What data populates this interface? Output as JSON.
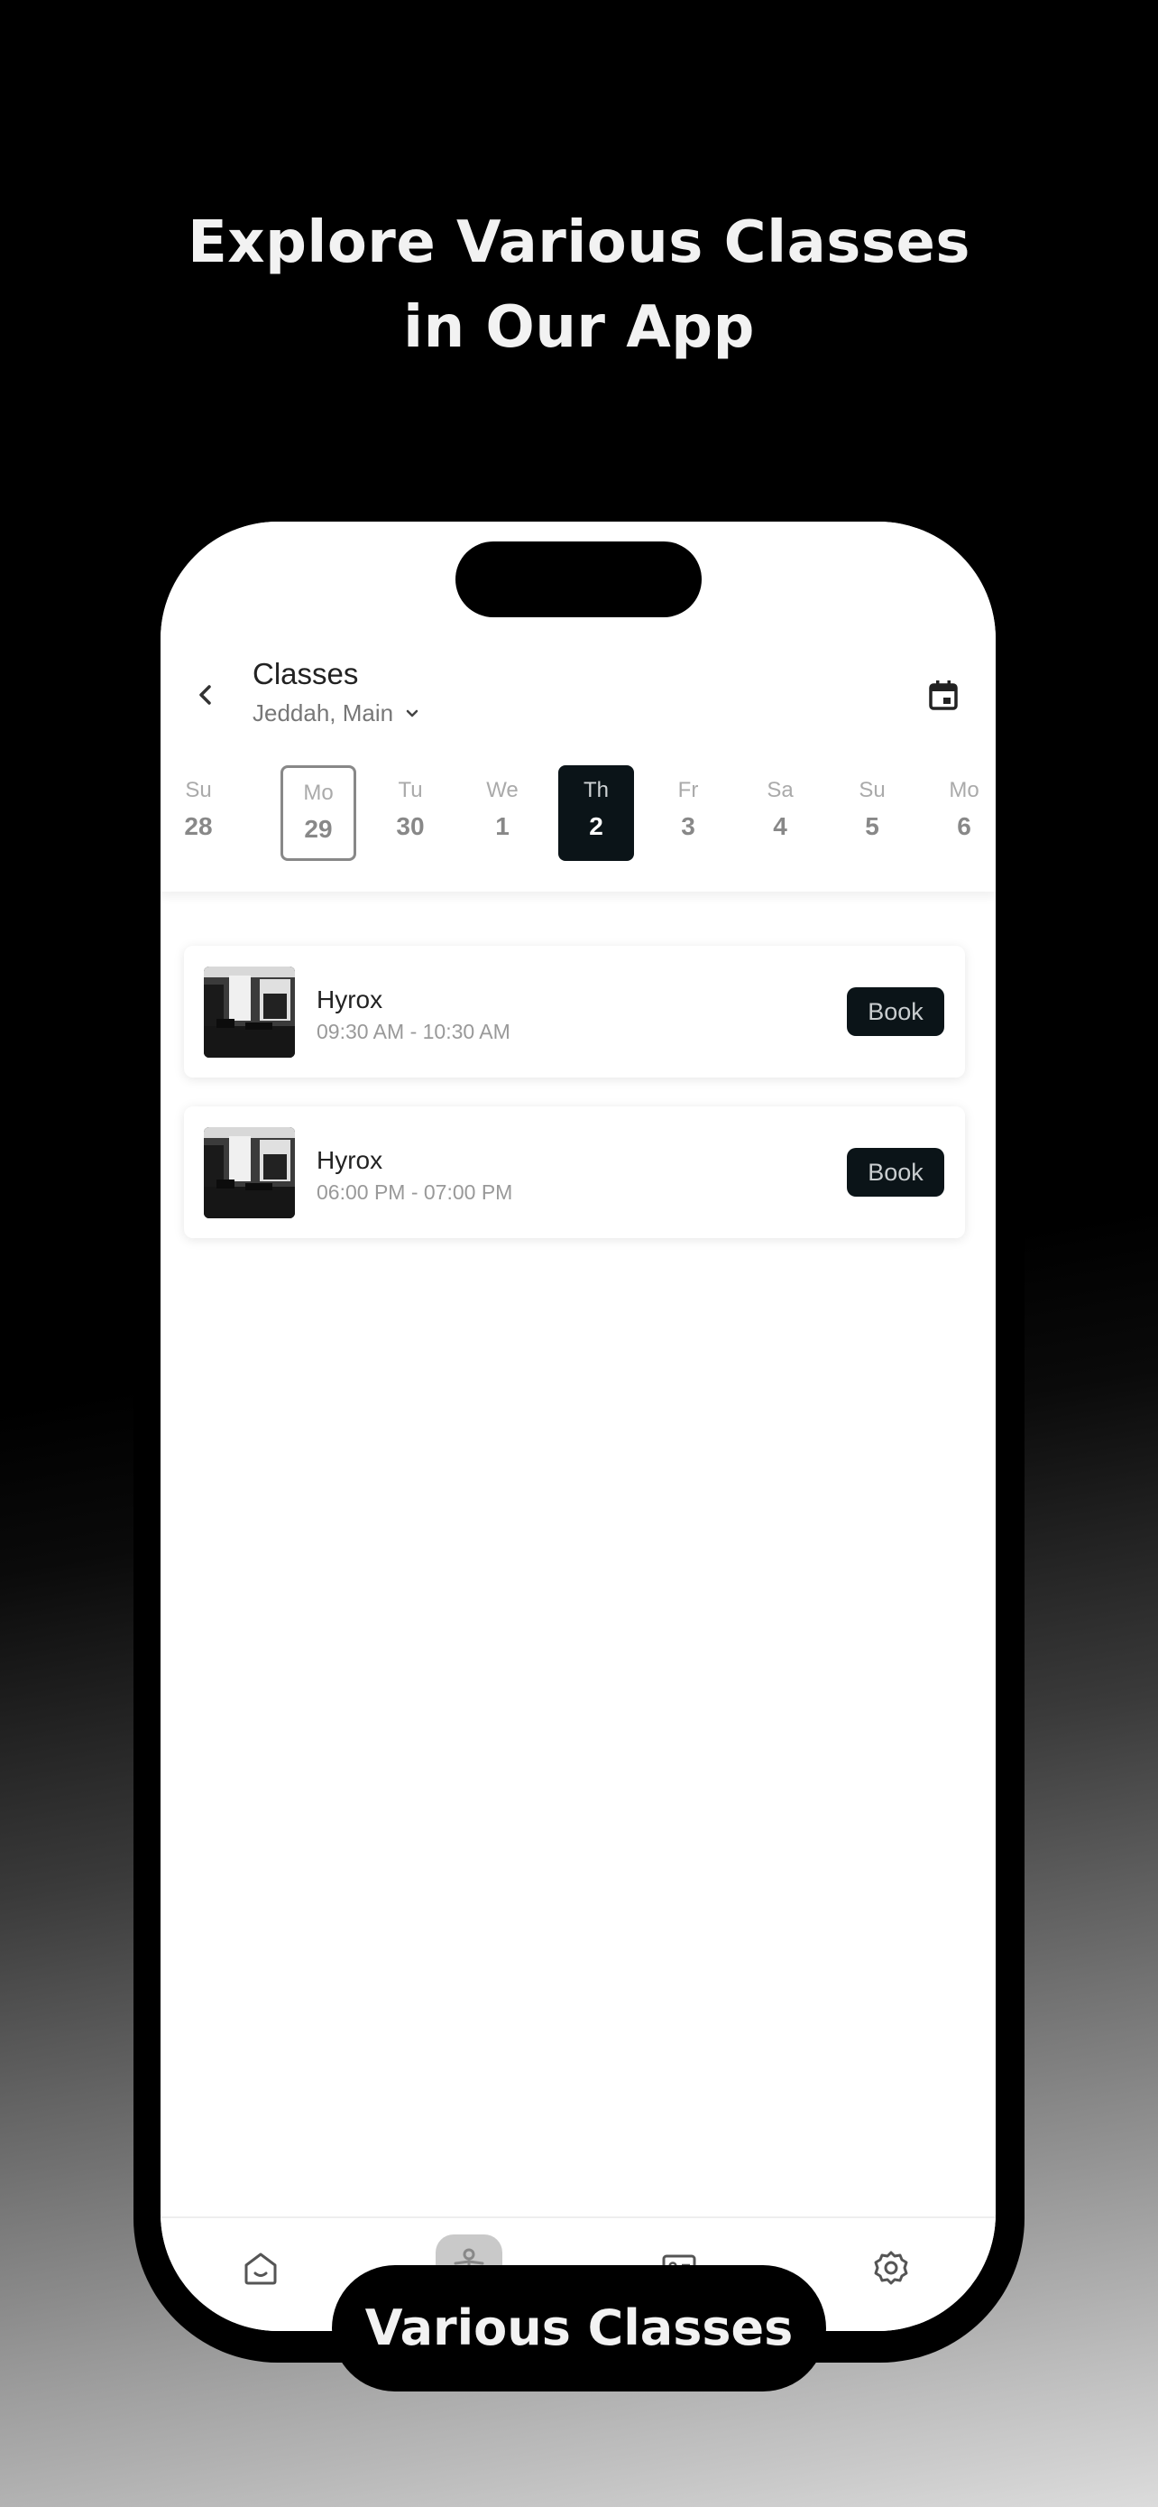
{
  "headline": {
    "line1": "Explore Various Classes",
    "line2": "in Our App"
  },
  "header": {
    "title": "Classes",
    "location": "Jeddah, Main",
    "back_icon": "chevron-left-icon",
    "calendar_icon": "calendar-icon"
  },
  "days": [
    {
      "name": "Su",
      "date": "28",
      "state": "normal"
    },
    {
      "name": "Mo",
      "date": "29",
      "state": "today"
    },
    {
      "name": "Tu",
      "date": "30",
      "state": "normal"
    },
    {
      "name": "We",
      "date": "1",
      "state": "normal"
    },
    {
      "name": "Th",
      "date": "2",
      "state": "selected"
    },
    {
      "name": "Fr",
      "date": "3",
      "state": "normal"
    },
    {
      "name": "Sa",
      "date": "4",
      "state": "normal"
    },
    {
      "name": "Su",
      "date": "5",
      "state": "normal"
    },
    {
      "name": "Mo",
      "date": "6",
      "state": "normal"
    }
  ],
  "classes": [
    {
      "name": "Hyrox",
      "time": "09:30 AM - 10:30 AM",
      "button": "Book"
    },
    {
      "name": "Hyrox",
      "time": "06:00 PM - 07:00 PM",
      "button": "Book"
    }
  ],
  "bottom_nav": [
    {
      "icon": "home-icon",
      "active": false
    },
    {
      "icon": "fitness-person-icon",
      "active": true
    },
    {
      "icon": "id-card-icon",
      "active": false
    },
    {
      "icon": "gear-icon",
      "active": false
    }
  ],
  "caption": "Various Classes",
  "colors": {
    "accent": "#0b1418",
    "background": "#000000"
  }
}
